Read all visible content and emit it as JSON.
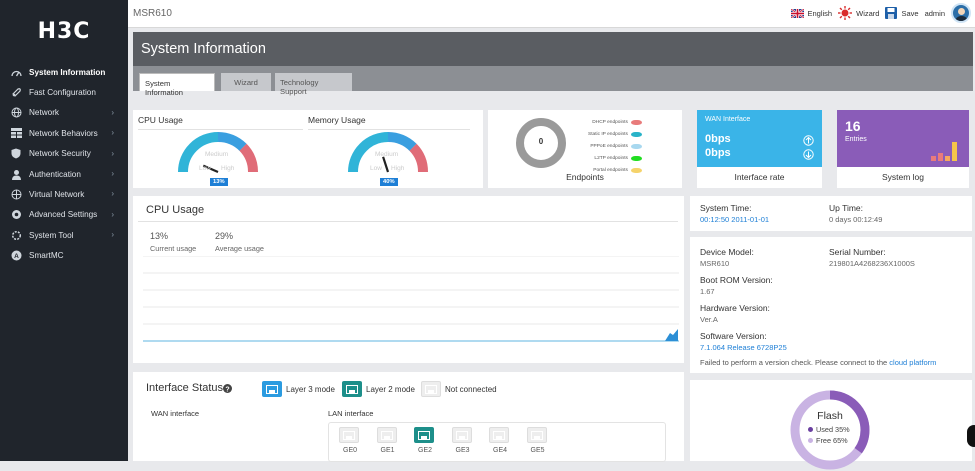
{
  "sidebar": {
    "logo": "H3C",
    "items": [
      {
        "label": "System Information",
        "icon": "dashboard-icon",
        "active": true,
        "chevron": ""
      },
      {
        "label": "Fast Configuration",
        "icon": "rocket-icon",
        "active": false,
        "chevron": ""
      },
      {
        "label": "Network",
        "icon": "globe-icon",
        "active": false,
        "chevron": "›"
      },
      {
        "label": "Network Behaviors",
        "icon": "grid-icon",
        "active": false,
        "chevron": "›"
      },
      {
        "label": "Network Security",
        "icon": "shield-icon",
        "active": false,
        "chevron": "›"
      },
      {
        "label": "Authentication",
        "icon": "user-icon",
        "active": false,
        "chevron": "›"
      },
      {
        "label": "Virtual Network",
        "icon": "network-icon",
        "active": false,
        "chevron": "›"
      },
      {
        "label": "Advanced Settings",
        "icon": "settings-icon",
        "active": false,
        "chevron": "›"
      },
      {
        "label": "System Tool",
        "icon": "tool-icon",
        "active": false,
        "chevron": "›"
      },
      {
        "label": "SmartMC",
        "icon": "smartmc-icon",
        "active": false,
        "chevron": ""
      }
    ]
  },
  "topbar": {
    "device_name": "MSR610",
    "language": "English",
    "wizard": "Wizard",
    "save": "Save",
    "user": "admin"
  },
  "page": {
    "title": "System Information",
    "tabs": [
      "System Information",
      "Wizard",
      "Technology Support"
    ]
  },
  "usage": {
    "cpu_title": "CPU Usage",
    "mem_title": "Memory Usage",
    "cpu_pct": "13%",
    "mem_pct": "40%",
    "cpu_value": 0.13,
    "mem_value": 0.4,
    "gauge_medium": "Medium",
    "gauge_low": "Low",
    "gauge_high": "High"
  },
  "endpoints": {
    "count": "0",
    "label": "Endpoints",
    "legend": [
      {
        "label": "DHCP endpoints",
        "color": "#e87b7b"
      },
      {
        "label": "Static IP endpoints",
        "color": "#29b3c8"
      },
      {
        "label": "PPPoE endpoints",
        "color": "#a8d8ef"
      },
      {
        "label": "L2TP endpoints",
        "color": "#22dd22"
      },
      {
        "label": "Portal endpoints",
        "color": "#f5d36b"
      }
    ]
  },
  "wan": {
    "title": "WAN Interface",
    "up": "0bps",
    "down": "0bps",
    "footer": "Interface rate",
    "color": "#3ab4e8"
  },
  "syslog": {
    "count": "16",
    "unit": "Entries",
    "footer": "System log",
    "color": "#8a5cb8"
  },
  "cpu_chart": {
    "title": "CPU Usage",
    "current_value": "13%",
    "current_label": "Current usage",
    "average_value": "29%",
    "average_label": "Average usage"
  },
  "sysinfo": {
    "system_time_label": "System Time:",
    "system_time_value": "00:12:50  2011-01-01",
    "uptime_label": "Up Time:",
    "uptime_value": "0 days   00:12:49",
    "model_label": "Device Model:",
    "model_value": "MSR610",
    "serial_label": "Serial Number:",
    "serial_value": "219801A4268236X1000S",
    "bootrom_label": "Boot ROM Version:",
    "bootrom_value": "1.67",
    "hardware_label": "Hardware Version:",
    "hardware_value": "Ver.A",
    "software_label": "Software Version:",
    "software_value": "7.1.064 Release 6728P25",
    "version_check_text": "Failed to perform a version check. Please connect to the",
    "version_check_link": "cloud platform"
  },
  "interface_status": {
    "title": "Interface Status",
    "legend_l3": "Layer 3 mode",
    "legend_l2": "Layer 2 mode",
    "legend_nc": "Not connected",
    "wan_label": "WAN interface",
    "lan_label": "LAN interface",
    "ports": [
      {
        "name": "GE0",
        "active": false
      },
      {
        "name": "GE1",
        "active": false
      },
      {
        "name": "GE2",
        "active": true
      },
      {
        "name": "GE3",
        "active": false
      },
      {
        "name": "GE4",
        "active": false
      },
      {
        "name": "GE5",
        "active": false
      }
    ]
  },
  "flash": {
    "title": "Flash",
    "used": "Used 35%",
    "free": "Free 65%",
    "used_value": 0.35
  }
}
